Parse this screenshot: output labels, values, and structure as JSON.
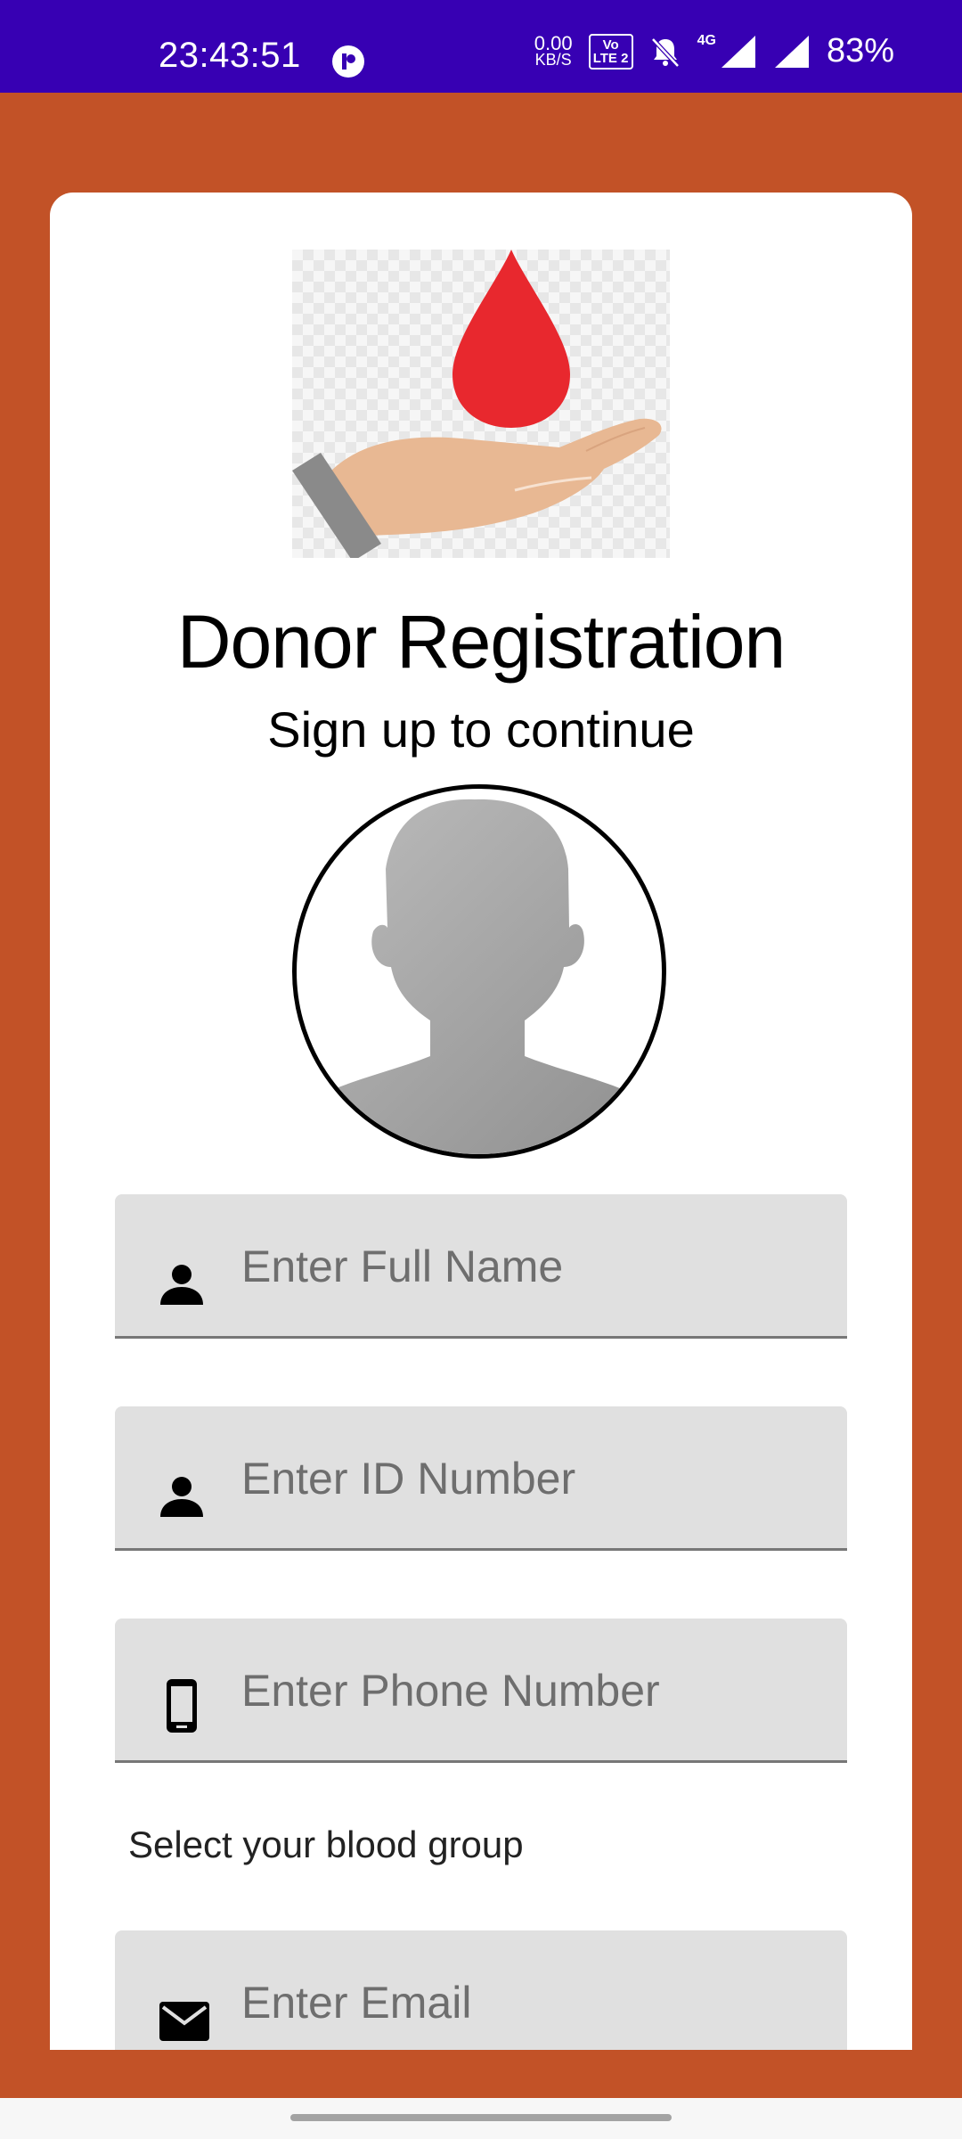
{
  "status_bar": {
    "time": "23:43:51",
    "net_speed_value": "0.00",
    "net_speed_unit": "KB/S",
    "volte_line1": "Vo",
    "volte_line2": "LTE 2",
    "network_type": "4G",
    "battery": "83%"
  },
  "header": {
    "title": "Donor Registration",
    "subtitle": "Sign up to continue"
  },
  "form": {
    "full_name_placeholder": "Enter Full Name",
    "id_number_placeholder": "Enter ID Number",
    "phone_placeholder": "Enter Phone Number",
    "blood_group_label": "Select your blood group",
    "email_placeholder": "Enter Email"
  },
  "colors": {
    "status_bar": "#3700b3",
    "background": "#c25227",
    "card": "#ffffff",
    "input_fill": "#e0e0e0",
    "blood_drop": "#e8282e"
  }
}
